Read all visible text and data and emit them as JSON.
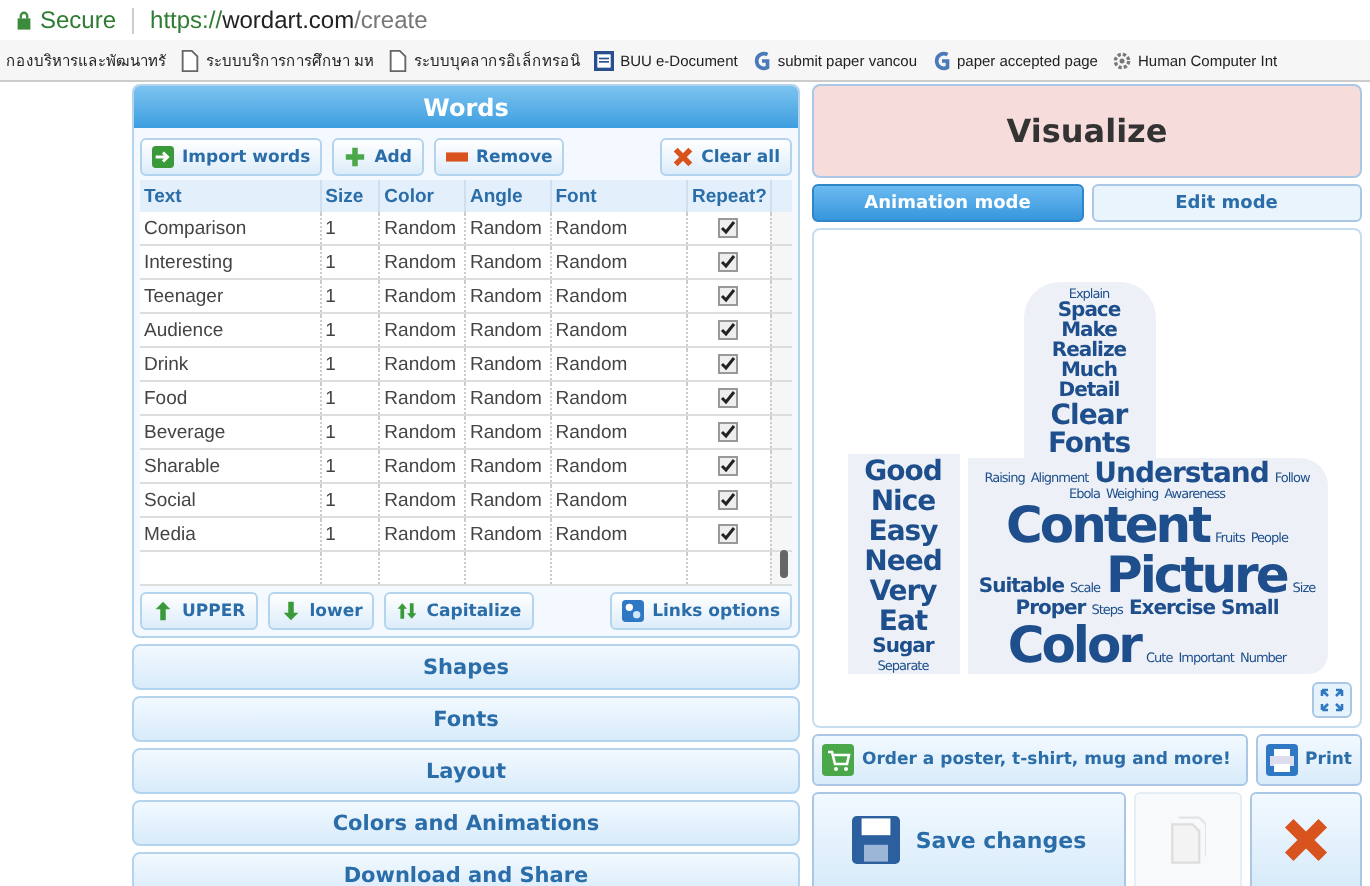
{
  "browser": {
    "secure_label": "Secure",
    "url": {
      "scheme": "https://",
      "host": "wordart.com",
      "path": "/create"
    }
  },
  "bookmarks": [
    {
      "label": "กองบริหารและพัฒนาทรั",
      "kind": "none"
    },
    {
      "label": "ระบบบริการการศึกษา มห",
      "kind": "page"
    },
    {
      "label": "ระบบบุคลากรอิเล็กทรอนิ",
      "kind": "page"
    },
    {
      "label": "BUU e-Document",
      "kind": "doc"
    },
    {
      "label": "submit paper vancou",
      "kind": "g"
    },
    {
      "label": "paper accepted page",
      "kind": "g"
    },
    {
      "label": "Human Computer Int",
      "kind": "gear"
    }
  ],
  "words_panel": {
    "title": "Words",
    "toolbar": [
      {
        "label": "Import words",
        "kind": "import"
      },
      {
        "label": "Add",
        "kind": "add"
      },
      {
        "label": "Remove",
        "kind": "remove"
      },
      {
        "label": "Clear all",
        "kind": "clear"
      }
    ],
    "table": {
      "columns": [
        "Text",
        "Size",
        "Color",
        "Angle",
        "Font",
        "Repeat?"
      ],
      "rows": [
        {
          "text": "Comparison",
          "size": "1",
          "color_setting": "Random",
          "angle": "Random",
          "font": "Random",
          "repeat": true
        },
        {
          "text": "Interesting",
          "size": "1",
          "color_setting": "Random",
          "angle": "Random",
          "font": "Random",
          "repeat": true
        },
        {
          "text": "Teenager",
          "size": "1",
          "color_setting": "Random",
          "angle": "Random",
          "font": "Random",
          "repeat": true
        },
        {
          "text": "Audience",
          "size": "1",
          "color_setting": "Random",
          "angle": "Random",
          "font": "Random",
          "repeat": true
        },
        {
          "text": "Drink",
          "size": "1",
          "color_setting": "Random",
          "angle": "Random",
          "font": "Random",
          "repeat": true
        },
        {
          "text": "Food",
          "size": "1",
          "color_setting": "Random",
          "angle": "Random",
          "font": "Random",
          "repeat": true
        },
        {
          "text": "Beverage",
          "size": "1",
          "color_setting": "Random",
          "angle": "Random",
          "font": "Random",
          "repeat": true
        },
        {
          "text": "Sharable",
          "size": "1",
          "color_setting": "Random",
          "angle": "Random",
          "font": "Random",
          "repeat": true
        },
        {
          "text": "Social",
          "size": "1",
          "color_setting": "Random",
          "angle": "Random",
          "font": "Random",
          "repeat": true
        },
        {
          "text": "Media",
          "size": "1",
          "color_setting": "Random",
          "angle": "Random",
          "font": "Random",
          "repeat": true
        }
      ]
    },
    "case_buttons": [
      {
        "label": "UPPER",
        "kind": "upper"
      },
      {
        "label": "lower",
        "kind": "lower"
      },
      {
        "label": "Capitalize",
        "kind": "capitalize"
      }
    ],
    "links_button": "Links options"
  },
  "sections": [
    "Shapes",
    "Fonts",
    "Layout",
    "Colors and Animations",
    "Download and Share"
  ],
  "visualize_button": "Visualize",
  "modes": [
    {
      "label": "Animation mode",
      "selected": true
    },
    {
      "label": "Edit mode",
      "selected": false
    }
  ],
  "word_cloud": {
    "cuff": [
      {
        "text": "Good",
        "kind": "large"
      },
      {
        "text": "Nice",
        "kind": "large"
      },
      {
        "text": "Easy",
        "kind": "large"
      },
      {
        "text": "Need",
        "kind": "large"
      },
      {
        "text": "Very",
        "kind": "large"
      },
      {
        "text": "Eat",
        "kind": "large"
      },
      {
        "text": "Sugar",
        "kind": "medium"
      },
      {
        "text": "Separate",
        "kind": "small"
      }
    ],
    "thumb": [
      {
        "text": "Explain",
        "kind": "small"
      },
      {
        "text": "Space",
        "kind": "medium"
      },
      {
        "text": "Make",
        "kind": "medium"
      },
      {
        "text": "Realize",
        "kind": "medium"
      },
      {
        "text": "Much",
        "kind": "medium"
      },
      {
        "text": "Detail",
        "kind": "medium"
      },
      {
        "text": "Clear",
        "kind": "large"
      },
      {
        "text": "Fonts",
        "kind": "large"
      }
    ],
    "palm": [
      {
        "text": "Raising",
        "kind": "small"
      },
      {
        "text": "Alignment",
        "kind": "small"
      },
      {
        "text": "Understand",
        "kind": "large"
      },
      {
        "text": "Follow",
        "kind": "small"
      },
      {
        "text": "Ebola",
        "kind": "small"
      },
      {
        "text": "Weighing",
        "kind": "small"
      },
      {
        "text": "Awareness",
        "kind": "small"
      },
      {
        "text": "Content",
        "kind": "big"
      },
      {
        "text": "Fruits",
        "kind": "small"
      },
      {
        "text": "People",
        "kind": "small"
      },
      {
        "text": "Suitable",
        "kind": "medium"
      },
      {
        "text": "Scale",
        "kind": "small"
      },
      {
        "text": "Picture",
        "kind": "big"
      },
      {
        "text": "Size",
        "kind": "small"
      },
      {
        "text": "Proper",
        "kind": "medium"
      },
      {
        "text": "Steps",
        "kind": "small"
      },
      {
        "text": "Exercise",
        "kind": "medium"
      },
      {
        "text": "Small",
        "kind": "medium"
      },
      {
        "text": "Color",
        "kind": "big"
      },
      {
        "text": "Cute",
        "kind": "small"
      },
      {
        "text": "Important",
        "kind": "small"
      },
      {
        "text": "Number",
        "kind": "small"
      }
    ]
  },
  "order_button": "Order a poster, t-shirt, mug and more!",
  "print_button": "Print",
  "save_button": "Save changes"
}
